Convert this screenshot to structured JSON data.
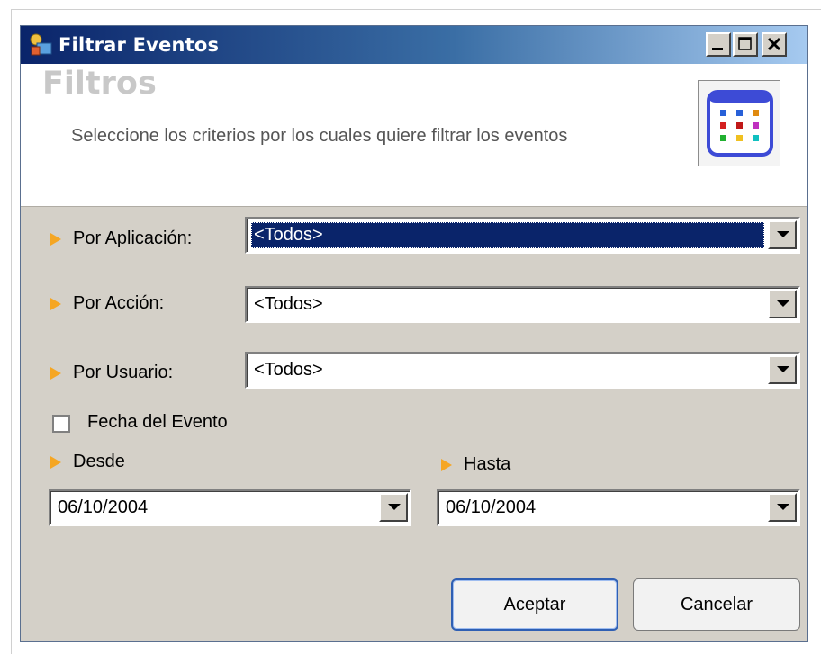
{
  "window": {
    "title": "Filtrar Eventos"
  },
  "header": {
    "title": "Filtros",
    "description": "Seleccione los criterios por los cuales quiere filtrar los eventos"
  },
  "filters": {
    "app_label": "Por Aplicación:",
    "app_value": "<Todos>",
    "action_label": "Por Acción:",
    "action_value": "<Todos>",
    "user_label": "Por Usuario:",
    "user_value": "<Todos>"
  },
  "date": {
    "checkbox_label": "Fecha del Evento",
    "checked": false,
    "from_label": "Desde",
    "from_value": "06/10/2004",
    "to_label": "Hasta",
    "to_value": "06/10/2004"
  },
  "buttons": {
    "ok": "Aceptar",
    "cancel": "Cancelar"
  },
  "colors": {
    "arrow": "#f5a623",
    "selection": "#0a246a",
    "titlebar_start": "#0a246a",
    "titlebar_end": "#a6caf0"
  },
  "icons": {
    "title": "filter-events-icon",
    "header": "colored-grid-icon",
    "row_marker": "orange-arrow-icon"
  }
}
